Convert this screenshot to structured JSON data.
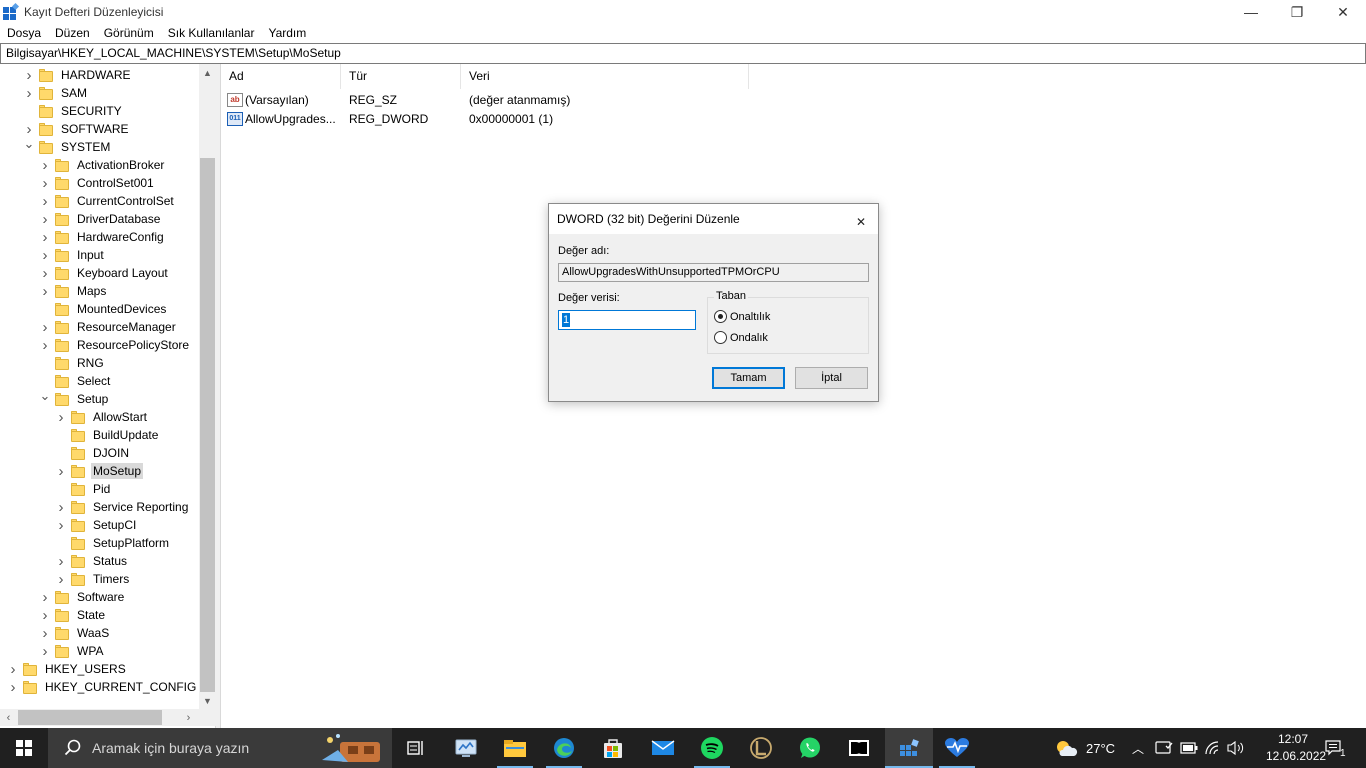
{
  "window": {
    "title": "Kayıt Defteri Düzenleyicisi",
    "minimize_glyph": "—",
    "maximize_glyph": "❐",
    "close_glyph": "✕"
  },
  "menu": [
    "Dosya",
    "Düzen",
    "Görünüm",
    "Sık Kullanılanlar",
    "Yardım"
  ],
  "address": "Bilgisayar\\HKEY_LOCAL_MACHINE\\SYSTEM\\Setup\\MoSetup",
  "tree": [
    {
      "label": "HARDWARE",
      "level": 2,
      "expanded": false
    },
    {
      "label": "SAM",
      "level": 2,
      "expanded": false
    },
    {
      "label": "SECURITY",
      "level": 2,
      "expanded": null
    },
    {
      "label": "SOFTWARE",
      "level": 2,
      "expanded": false
    },
    {
      "label": "SYSTEM",
      "level": 2,
      "expanded": true
    },
    {
      "label": "ActivationBroker",
      "level": 3,
      "expanded": false
    },
    {
      "label": "ControlSet001",
      "level": 3,
      "expanded": false
    },
    {
      "label": "CurrentControlSet",
      "level": 3,
      "expanded": false
    },
    {
      "label": "DriverDatabase",
      "level": 3,
      "expanded": false
    },
    {
      "label": "HardwareConfig",
      "level": 3,
      "expanded": false
    },
    {
      "label": "Input",
      "level": 3,
      "expanded": false
    },
    {
      "label": "Keyboard Layout",
      "level": 3,
      "expanded": false
    },
    {
      "label": "Maps",
      "level": 3,
      "expanded": false
    },
    {
      "label": "MountedDevices",
      "level": 3,
      "expanded": null
    },
    {
      "label": "ResourceManager",
      "level": 3,
      "expanded": false
    },
    {
      "label": "ResourcePolicyStore",
      "level": 3,
      "expanded": false
    },
    {
      "label": "RNG",
      "level": 3,
      "expanded": null
    },
    {
      "label": "Select",
      "level": 3,
      "expanded": null
    },
    {
      "label": "Setup",
      "level": 3,
      "expanded": true
    },
    {
      "label": "AllowStart",
      "level": 4,
      "expanded": false
    },
    {
      "label": "BuildUpdate",
      "level": 4,
      "expanded": null
    },
    {
      "label": "DJOIN",
      "level": 4,
      "expanded": null
    },
    {
      "label": "MoSetup",
      "level": 4,
      "expanded": false,
      "selected": true
    },
    {
      "label": "Pid",
      "level": 4,
      "expanded": null
    },
    {
      "label": "Service Reporting",
      "level": 4,
      "expanded": false
    },
    {
      "label": "SetupCI",
      "level": 4,
      "expanded": false
    },
    {
      "label": "SetupPlatform",
      "level": 4,
      "expanded": null
    },
    {
      "label": "Status",
      "level": 4,
      "expanded": false
    },
    {
      "label": "Timers",
      "level": 4,
      "expanded": false
    },
    {
      "label": "Software",
      "level": 3,
      "expanded": false
    },
    {
      "label": "State",
      "level": 3,
      "expanded": false
    },
    {
      "label": "WaaS",
      "level": 3,
      "expanded": false
    },
    {
      "label": "WPA",
      "level": 3,
      "expanded": false
    },
    {
      "label": "HKEY_USERS",
      "level": 1,
      "expanded": false
    },
    {
      "label": "HKEY_CURRENT_CONFIG",
      "level": 1,
      "expanded": false
    }
  ],
  "list": {
    "columns": [
      "Ad",
      "Tür",
      "Veri"
    ],
    "rows": [
      {
        "icon": "string-value-icon",
        "icon_text": "ab",
        "name": "(Varsayılan)",
        "type": "REG_SZ",
        "data": "(değer atanmamış)"
      },
      {
        "icon": "binary-value-icon",
        "icon_text": "011",
        "name": "AllowUpgrades...",
        "type": "REG_DWORD",
        "data": "0x00000001 (1)"
      }
    ]
  },
  "dialog": {
    "title": "DWORD (32 bit) Değerini Düzenle",
    "name_label": "Değer adı:",
    "name_value": "AllowUpgradesWithUnsupportedTPMOrCPU",
    "data_label": "Değer verisi:",
    "data_value": "1",
    "base_label": "Taban",
    "radio_hex": "Onaltılık",
    "radio_dec": "Ondalık",
    "base_selected": "Onaltılık",
    "ok_label": "Tamam",
    "cancel_label": "İptal"
  },
  "taskbar": {
    "search_placeholder": "Aramak için buraya yazın",
    "temperature": "27°C",
    "time": "12:07",
    "date": "12.06.2022",
    "notification_count": "1"
  },
  "colors": {
    "accent": "#0078d7",
    "taskbar": "#202020",
    "folder": "#ffd96b"
  }
}
